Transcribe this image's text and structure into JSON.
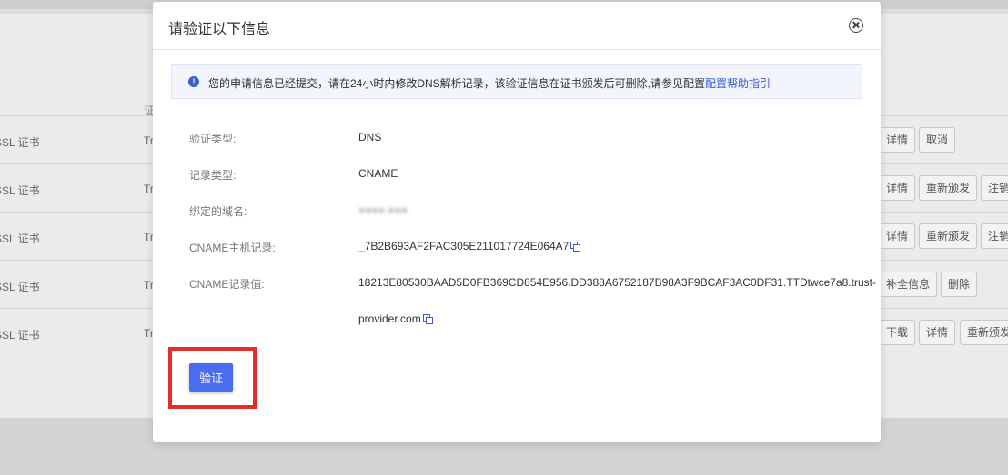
{
  "background": {
    "column_header": "证",
    "rows": [
      {
        "name": "SSL 证书",
        "tr": "Tr",
        "buttons": [
          "详情",
          "取消"
        ]
      },
      {
        "name": "SSL 证书",
        "tr": "Tr",
        "buttons": [
          "详情",
          "重新颁发",
          "注销"
        ]
      },
      {
        "name": "SSL 证书",
        "tr": "Tr",
        "buttons": [
          "详情",
          "重新颁发",
          "注销"
        ]
      },
      {
        "name": "SSL 证书",
        "tr": "Tr",
        "buttons": [
          "补全信息",
          "删除"
        ]
      },
      {
        "name": "SSL 证书",
        "tr": "Tr",
        "buttons": [
          "下载",
          "详情",
          "重新颁发"
        ]
      }
    ]
  },
  "modal": {
    "title": "请验证以下信息",
    "notice": {
      "text": "您的申请信息已经提交，请在24小时内修改DNS解析记录，该验证信息在证书颁发后可删除,请参见配置",
      "link": "配置帮助指引"
    },
    "fields": [
      {
        "label": "验证类型:",
        "value": "DNS"
      },
      {
        "label": "记录类型:",
        "value": "CNAME"
      },
      {
        "label": "绑定的域名:",
        "value": "●●●●.●●●"
      },
      {
        "label": "CNAME主机记录:",
        "value": "_7B2B693AF2FAC305E211017724E064A7"
      },
      {
        "label": "CNAME记录值:",
        "value": "18213E80530BAAD5D0FB369CD854E956.DD388A6752187B98A3F9BCAF3AC0DF31.TTDtwce7a8.trust-",
        "value_line2": "provider.com"
      }
    ],
    "verify_button": "验证"
  },
  "colors": {
    "primary": "#4a6cf0",
    "highlight": "#e62b2b",
    "link": "#3d5bd9"
  }
}
